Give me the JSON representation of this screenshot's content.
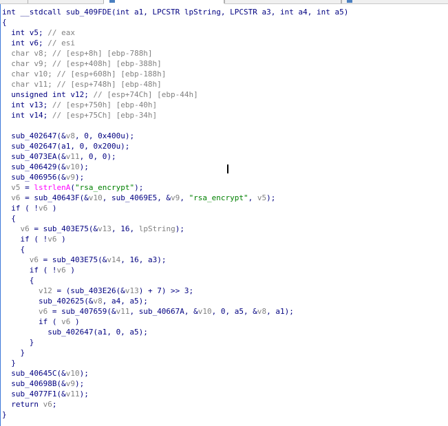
{
  "lines": [
    [
      [
        "int __stdcall sub_409FDE(int a1, LPCSTR lpString, LPCSTR a3, int a4, int a5)",
        "d"
      ]
    ],
    [
      [
        "{",
        "d"
      ]
    ],
    [
      [
        "  int v5; ",
        "d"
      ],
      [
        "// eax",
        "c"
      ]
    ],
    [
      [
        "  int v6; ",
        "d"
      ],
      [
        "// esi",
        "c"
      ]
    ],
    [
      [
        "  char v8; ",
        "c"
      ],
      [
        "// [esp+8h] [ebp-788h]",
        "c"
      ]
    ],
    [
      [
        "  char v9; ",
        "c"
      ],
      [
        "// [esp+408h] [ebp-388h]",
        "c"
      ]
    ],
    [
      [
        "  char v10; ",
        "c"
      ],
      [
        "// [esp+608h] [ebp-188h]",
        "c"
      ]
    ],
    [
      [
        "  char v11; ",
        "c"
      ],
      [
        "// [esp+748h] [ebp-48h]",
        "c"
      ]
    ],
    [
      [
        "  unsigned int v12; ",
        "d"
      ],
      [
        "// [esp+74Ch] [ebp-44h]",
        "c"
      ]
    ],
    [
      [
        "  int v13; ",
        "d"
      ],
      [
        "// [esp+750h] [ebp-40h]",
        "c"
      ]
    ],
    [
      [
        "  int v14; ",
        "d"
      ],
      [
        "// [esp+75Ch] [ebp-34h]",
        "c"
      ]
    ],
    [
      [
        "",
        "d"
      ]
    ],
    [
      [
        "  sub_402647(&",
        "d"
      ],
      [
        "v8",
        "v"
      ],
      [
        ", 0, 0x400u);",
        "d"
      ]
    ],
    [
      [
        "  sub_402647(a1, 0, 0x200u);",
        "d"
      ]
    ],
    [
      [
        "  sub_4073EA(&",
        "d"
      ],
      [
        "v11",
        "v"
      ],
      [
        ", 0, 0);",
        "d"
      ]
    ],
    [
      [
        "  sub_406429(&",
        "d"
      ],
      [
        "v10",
        "v"
      ],
      [
        ");",
        "d"
      ]
    ],
    [
      [
        "  sub_406956(&",
        "d"
      ],
      [
        "v9",
        "v"
      ],
      [
        ");",
        "d"
      ]
    ],
    [
      [
        "  ",
        "d"
      ],
      [
        "v5",
        "v"
      ],
      [
        " = ",
        "d"
      ],
      [
        "lstrlenA",
        "a"
      ],
      [
        "(",
        "d"
      ],
      [
        "\"rsa_encrypt\"",
        "s"
      ],
      [
        ");",
        "d"
      ]
    ],
    [
      [
        "  ",
        "d"
      ],
      [
        "v6",
        "v"
      ],
      [
        " = sub_40643F(&",
        "d"
      ],
      [
        "v10",
        "v"
      ],
      [
        ", sub_4069E5, &",
        "d"
      ],
      [
        "v9",
        "v"
      ],
      [
        ", ",
        "d"
      ],
      [
        "\"rsa_encrypt\"",
        "s"
      ],
      [
        ", ",
        "d"
      ],
      [
        "v5",
        "v"
      ],
      [
        ");",
        "d"
      ]
    ],
    [
      [
        "  if ( !",
        "d"
      ],
      [
        "v6",
        "v"
      ],
      [
        " )",
        "d"
      ]
    ],
    [
      [
        "  {",
        "d"
      ]
    ],
    [
      [
        "    ",
        "d"
      ],
      [
        "v6",
        "v"
      ],
      [
        " = sub_403E75(&",
        "d"
      ],
      [
        "v13",
        "v"
      ],
      [
        ", 16, ",
        "d"
      ],
      [
        "lpString",
        "v"
      ],
      [
        ");",
        "d"
      ]
    ],
    [
      [
        "    if ( !",
        "d"
      ],
      [
        "v6",
        "v"
      ],
      [
        " )",
        "d"
      ]
    ],
    [
      [
        "    {",
        "d"
      ]
    ],
    [
      [
        "      ",
        "d"
      ],
      [
        "v6",
        "v"
      ],
      [
        " = sub_403E75(&",
        "d"
      ],
      [
        "v14",
        "v"
      ],
      [
        ", 16, a3);",
        "d"
      ]
    ],
    [
      [
        "      if ( !",
        "d"
      ],
      [
        "v6",
        "v"
      ],
      [
        " )",
        "d"
      ]
    ],
    [
      [
        "      {",
        "d"
      ]
    ],
    [
      [
        "        ",
        "d"
      ],
      [
        "v12",
        "v"
      ],
      [
        " = (sub_403E26(&",
        "d"
      ],
      [
        "v13",
        "v"
      ],
      [
        ") + 7) >> 3;",
        "d"
      ]
    ],
    [
      [
        "        sub_402625(&",
        "d"
      ],
      [
        "v8",
        "v"
      ],
      [
        ", a4, a5);",
        "d"
      ]
    ],
    [
      [
        "        ",
        "d"
      ],
      [
        "v6",
        "v"
      ],
      [
        " = sub_407659(&",
        "d"
      ],
      [
        "v11",
        "v"
      ],
      [
        ", sub_40667A, &",
        "d"
      ],
      [
        "v10",
        "v"
      ],
      [
        ", 0, a5, &",
        "d"
      ],
      [
        "v8",
        "v"
      ],
      [
        ", a1);",
        "d"
      ]
    ],
    [
      [
        "        if ( ",
        "d"
      ],
      [
        "v6",
        "v"
      ],
      [
        " )",
        "d"
      ]
    ],
    [
      [
        "          sub_402647(a1, 0, a5);",
        "d"
      ]
    ],
    [
      [
        "      }",
        "d"
      ]
    ],
    [
      [
        "    }",
        "d"
      ]
    ],
    [
      [
        "  }",
        "d"
      ]
    ],
    [
      [
        "  sub_40645C(&",
        "d"
      ],
      [
        "v10",
        "v"
      ],
      [
        ");",
        "d"
      ]
    ],
    [
      [
        "  sub_40698B(&",
        "d"
      ],
      [
        "v9",
        "v"
      ],
      [
        ");",
        "d"
      ]
    ],
    [
      [
        "  sub_4077F1(&",
        "d"
      ],
      [
        "v11",
        "v"
      ],
      [
        ");",
        "d"
      ]
    ],
    [
      [
        "  return ",
        "d"
      ],
      [
        "v6",
        "v"
      ],
      [
        ";",
        "d"
      ]
    ],
    [
      [
        "}",
        "d"
      ]
    ]
  ]
}
